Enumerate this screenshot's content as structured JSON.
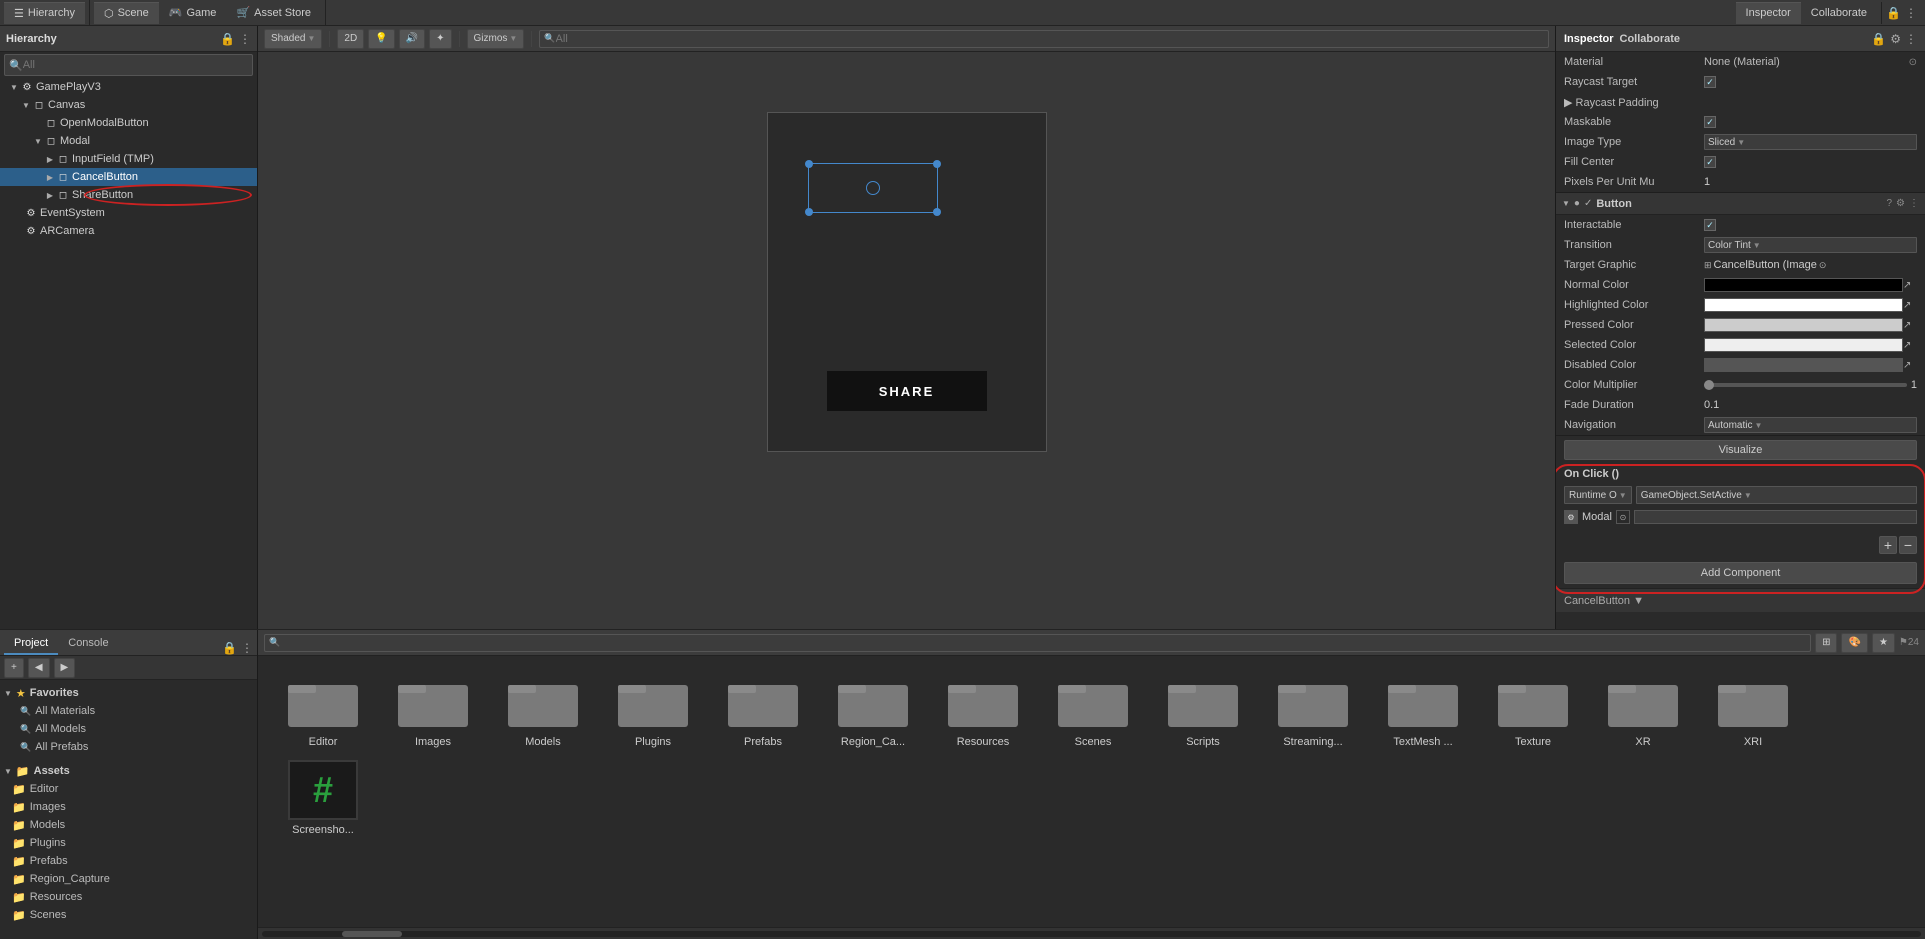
{
  "tabs": {
    "hierarchy": "Hierarchy",
    "scene": "Scene",
    "game": "Game",
    "assetStore": "Asset Store",
    "inspector": "Inspector",
    "collaborate": "Collaborate"
  },
  "panels": {
    "hierarchy": {
      "title": "Hierarchy",
      "searchPlaceholder": "All"
    }
  },
  "hierarchy": {
    "items": [
      {
        "name": "GamePlayV3"
      },
      {
        "name": "Canvas"
      },
      {
        "name": "OpenModalButton"
      },
      {
        "name": "Modal"
      },
      {
        "name": "InputField (TMP)"
      },
      {
        "name": "CancelButton"
      },
      {
        "name": "ShareButton"
      },
      {
        "name": "EventSystem"
      },
      {
        "name": "ARCamera"
      }
    ]
  },
  "sceneToolbar": {
    "shaded": "Shaded",
    "btn2D": "2D",
    "gizmos": "Gizmos",
    "searchPlaceholder": "All"
  },
  "sceneView": {
    "shareLabel": "SHARE"
  },
  "inspector": {
    "image": {
      "material": {
        "label": "Material",
        "value": "None (Material)"
      },
      "raycastTarget": {
        "label": "Raycast Target"
      },
      "raycastPadding": {
        "label": "▶ Raycast Padding"
      },
      "maskable": {
        "label": "Maskable"
      },
      "imageType": {
        "label": "Image Type",
        "value": "Sliced"
      },
      "fillCenter": {
        "label": "Fill Center"
      },
      "pixelsPerUnit": {
        "label": "Pixels Per Unit Mu",
        "value": "1"
      }
    },
    "button": {
      "title": "Button",
      "interactable": {
        "label": "Interactable"
      },
      "transition": {
        "label": "Transition",
        "value": "Color Tint"
      },
      "targetGraphic": {
        "label": "Target Graphic",
        "value": "CancelButton (Image"
      },
      "normalColor": {
        "label": "Normal Color"
      },
      "highlightedColor": {
        "label": "Highlighted Color"
      },
      "pressedColor": {
        "label": "Pressed Color"
      },
      "selectedColor": {
        "label": "Selected Color"
      },
      "disabledColor": {
        "label": "Disabled Color"
      },
      "colorMultiplier": {
        "label": "Color Multiplier",
        "value": "1"
      },
      "fadeDuration": {
        "label": "Fade Duration",
        "value": "0.1"
      },
      "navigation": {
        "label": "Navigation",
        "value": "Automatic"
      },
      "visualize": "Visualize",
      "onClick": {
        "label": "On Click ()",
        "runtime": "Runtime O",
        "function": "GameObject.SetActive",
        "target": "Modal"
      }
    },
    "addComponent": "Add Component",
    "footer": "CancelButton ▼"
  },
  "bottomTabs": {
    "project": "Project",
    "console": "Console"
  },
  "bottomPanel": {
    "favorites": {
      "title": "Favorites",
      "items": [
        "All Materials",
        "All Models",
        "All Prefabs"
      ]
    },
    "assets": {
      "title": "Assets",
      "count": "⚑24",
      "items": [
        "Editor",
        "Images",
        "Models",
        "Plugins",
        "Prefabs",
        "Region_Capture",
        "Resources",
        "Scenes"
      ]
    }
  },
  "assetGrid": {
    "row1": [
      {
        "label": "Editor"
      },
      {
        "label": "Images"
      },
      {
        "label": "Models"
      },
      {
        "label": "Plugins"
      },
      {
        "label": "Prefabs"
      },
      {
        "label": "Region_Ca..."
      },
      {
        "label": "Resources"
      },
      {
        "label": "Scenes"
      },
      {
        "label": "Scripts"
      }
    ],
    "row2": [
      {
        "label": "Streaming..."
      },
      {
        "label": "TextMesh ..."
      },
      {
        "label": "Texture"
      },
      {
        "label": "XR"
      },
      {
        "label": "XRI"
      },
      {
        "label": "Screensho..."
      }
    ]
  }
}
